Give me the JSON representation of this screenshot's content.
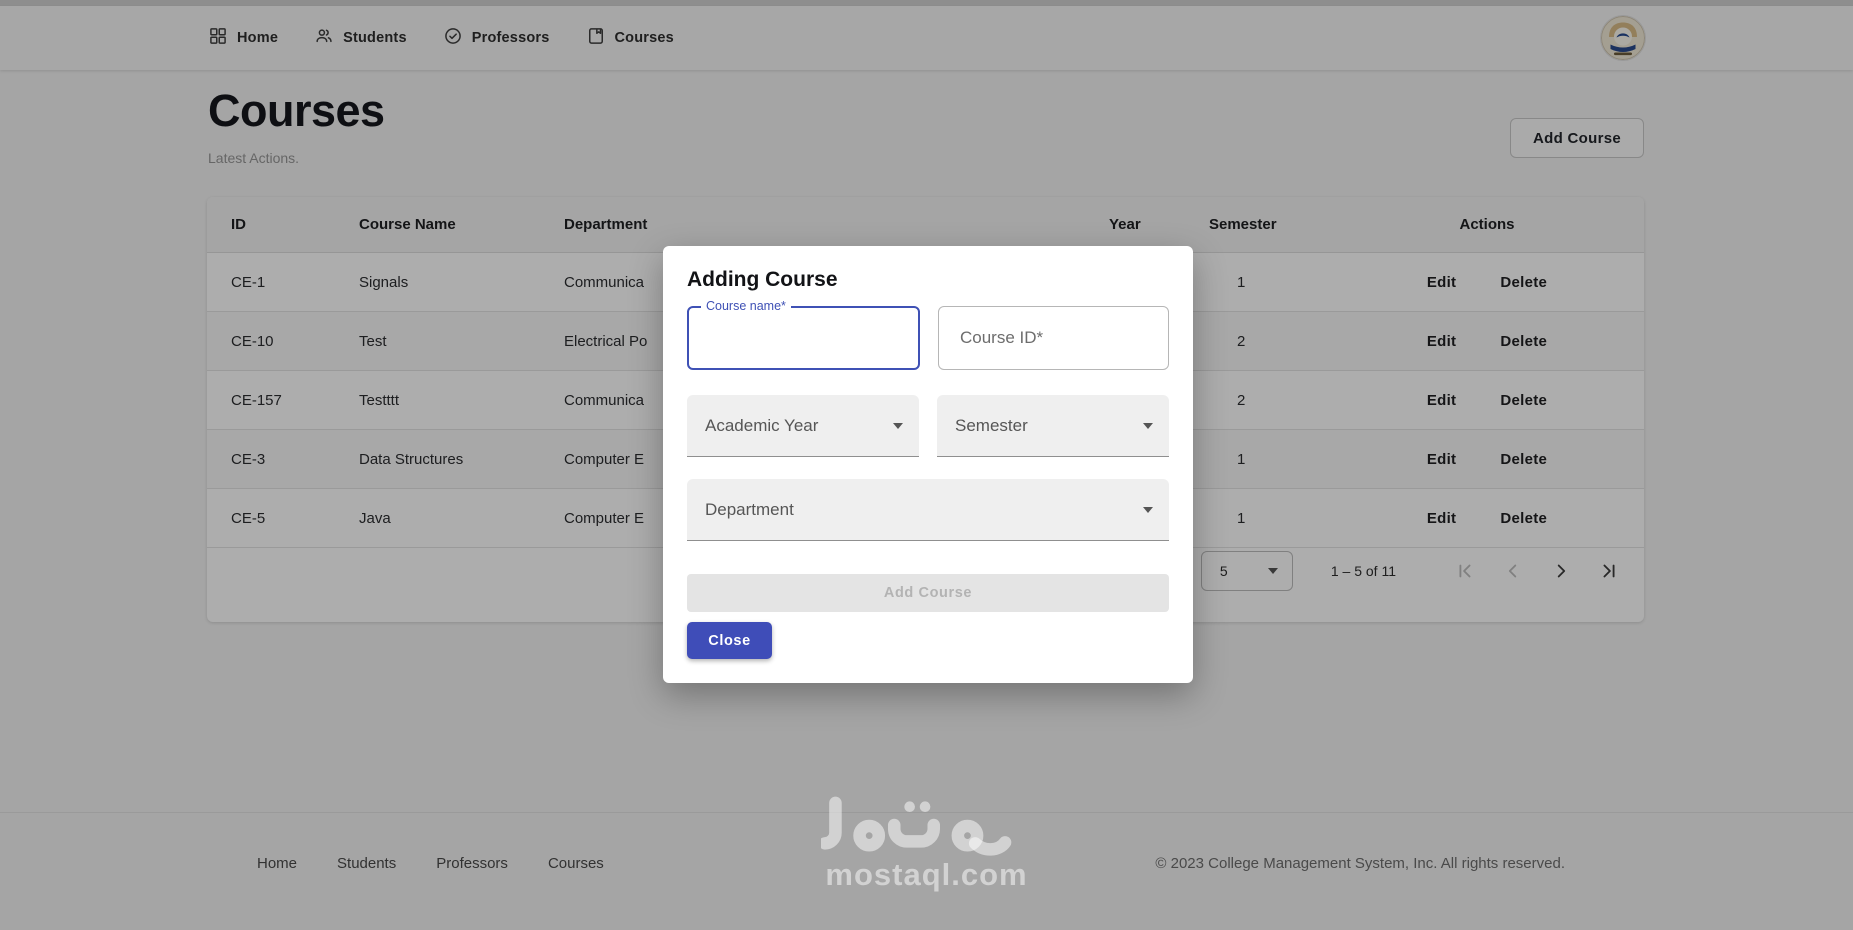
{
  "topnav": {
    "items": [
      {
        "label": "Home",
        "icon": "dashboard-icon"
      },
      {
        "label": "Students",
        "icon": "people-icon"
      },
      {
        "label": "Professors",
        "icon": "check-circle-icon"
      },
      {
        "label": "Courses",
        "icon": "book-icon"
      }
    ],
    "avatar": "university-crest-avatar"
  },
  "page": {
    "title": "Courses",
    "subtitle": "Latest Actions.",
    "add_course_button": "Add Course"
  },
  "table": {
    "columns": [
      "ID",
      "Course Name",
      "Department",
      "Year",
      "Semester",
      "Actions"
    ],
    "rows": [
      {
        "id": "CE-1",
        "course_name": "Signals",
        "department": "Communica",
        "year": "",
        "semester": "1"
      },
      {
        "id": "CE-10",
        "course_name": "Test",
        "department": "Electrical Po",
        "year": "",
        "semester": "2"
      },
      {
        "id": "CE-157",
        "course_name": "Testttt",
        "department": "Communica",
        "year": "",
        "semester": "2"
      },
      {
        "id": "CE-3",
        "course_name": "Data Structures",
        "department": "Computer E",
        "year": "",
        "semester": "1"
      },
      {
        "id": "CE-5",
        "course_name": "Java",
        "department": "Computer E",
        "year": "",
        "semester": "1"
      }
    ],
    "row_actions": {
      "edit": "Edit",
      "delete": "Delete"
    },
    "pagination": {
      "page_size": "5",
      "range_label": "1 – 5 of 11",
      "icons": [
        "first-page-icon",
        "prev-page-icon",
        "next-page-icon",
        "last-page-icon"
      ]
    }
  },
  "modal": {
    "title": "Adding Course",
    "course_name_label": "Course name*",
    "course_name_value": "",
    "course_id_label": "Course ID*",
    "academic_year_label": "Academic Year",
    "semester_label": "Semester",
    "department_label": "Department",
    "submit_label": "Add Course",
    "close_label": "Close"
  },
  "footer": {
    "links": [
      "Home",
      "Students",
      "Professors",
      "Courses"
    ],
    "copyright": "© 2023 College Management System, Inc. All rights reserved."
  },
  "watermark": {
    "latin": "mostaql.com"
  },
  "colors": {
    "primary_indigo": "#3f4db8",
    "focus_border": "#3f51b5",
    "backdrop": "rgba(0,0,0,0.32)",
    "card_bg": "#ffffff",
    "disabled_btn_bg": "#e4e4e4"
  }
}
